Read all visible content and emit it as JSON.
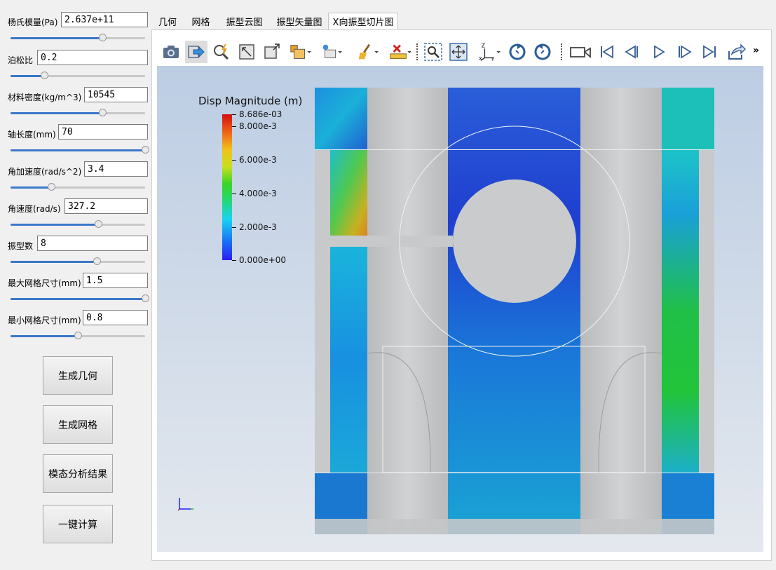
{
  "params": [
    {
      "label": "杨氏模量(Pa)",
      "value": "2.637e+11",
      "slider": 0.68
    },
    {
      "label": "泊松比",
      "value": "0.2",
      "slider": 0.25
    },
    {
      "label": "材料密度(kg/m^3)",
      "value": "10545",
      "slider": 0.68
    },
    {
      "label": "轴长度(mm)",
      "value": "70",
      "slider": 1.0
    },
    {
      "label": "角加速度(rad/s^2)",
      "value": "3.4",
      "slider": 0.3
    },
    {
      "label": "角速度(rad/s)",
      "value": "327.2",
      "slider": 0.65
    },
    {
      "label": "振型数",
      "value": "8",
      "slider": 0.64
    },
    {
      "label": "最大网格尺寸(mm)",
      "value": "1.5",
      "slider": 1.0
    },
    {
      "label": "最小网格尺寸(mm)",
      "value": "0.8",
      "slider": 0.5
    }
  ],
  "buttons": {
    "generate_geometry": "生成几何",
    "generate_mesh": "生成网格",
    "modal_results": "模态分析结果",
    "one_click": "一键计算"
  },
  "tabs": [
    "几何",
    "网格",
    "振型云图",
    "振型矢量图",
    "X向振型切片图"
  ],
  "active_tab": 4,
  "toolbar": {
    "icons": [
      "camera-icon",
      "interact-mode-icon",
      "select-icon",
      "reset-camera-icon",
      "zoom-to-box-icon",
      "representation-icon",
      "surface-icon",
      "clear-icon",
      "ruler-icon",
      "zoom-region-icon",
      "fit-view-icon",
      "axes-icon",
      "rotate-ccw-icon",
      "rotate-cw-icon",
      "video-camera-icon",
      "first-frame-icon",
      "prev-frame-icon",
      "play-icon",
      "next-frame-icon",
      "last-frame-icon",
      "export-icon"
    ],
    "overflow": "»"
  },
  "colorbar": {
    "title": "Disp Magnitude (m)",
    "max_label": "8.686e-03",
    "ticks": [
      "8.000e-3",
      "6.000e-3",
      "4.000e-3",
      "2.000e-3",
      "0.000e+00"
    ]
  },
  "colors": {
    "accent": "#3a78c9",
    "mesh_gray": "#c4c6c8",
    "blue": "#1d6fd8",
    "green": "#1fc43a"
  }
}
